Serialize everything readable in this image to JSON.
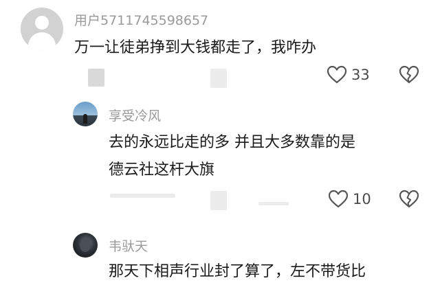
{
  "comments": [
    {
      "username": "用户5711745598657",
      "text": "万一让徒弟挣到大钱都走了，我咋办",
      "like_count": "33",
      "icons": {
        "avatar": "default-user-avatar",
        "like": "heart-icon",
        "dislike": "broken-heart-icon"
      }
    },
    {
      "username": "享受冷风",
      "text_line1": "去的永远比走的多  并且大多数靠的是",
      "text_line2": "德云社这杆大旗",
      "like_count": "10",
      "icons": {
        "avatar": "sky-photo-avatar",
        "like": "heart-icon",
        "dislike": "broken-heart-icon"
      }
    },
    {
      "username": "韦驮天",
      "text": "那天下相声行业封了算了，左不带货比",
      "icons": {
        "avatar": "dark-photo-avatar"
      }
    }
  ],
  "colors": {
    "username": "#9a9a9a",
    "text": "#1a1a1a",
    "icon": "#555555"
  }
}
